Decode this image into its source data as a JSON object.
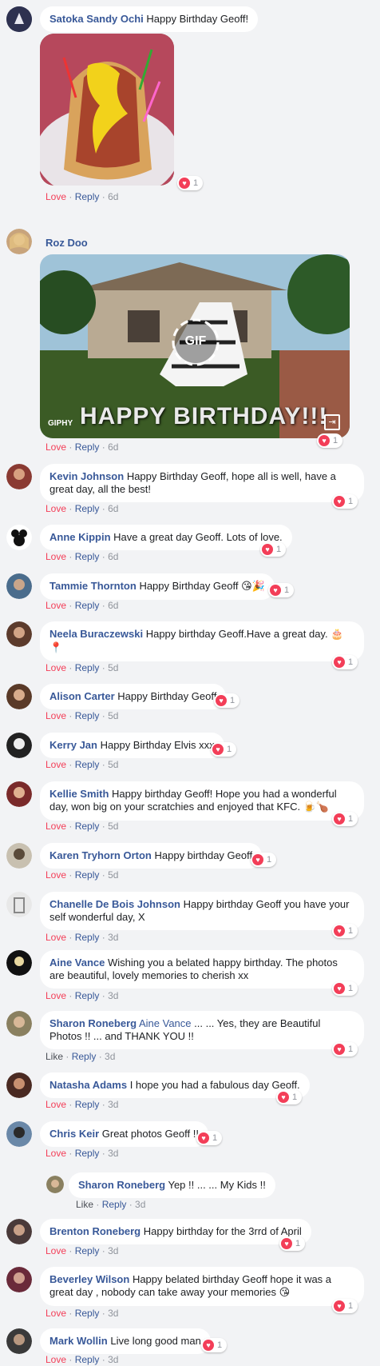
{
  "comments": [
    {
      "name": "Satoka Sandy Ochi",
      "text": "Happy Birthday Geoff!",
      "reaction": "Love",
      "reply": "Reply",
      "time": "6d",
      "count": "1"
    },
    {
      "name": "Roz Doo",
      "text": "",
      "reaction": "Love",
      "reply": "Reply",
      "time": "6d",
      "count": "1",
      "gif_caption": "HAPPY BIRTHDAY!!!",
      "gif_label": "GIF",
      "giphy": "GIPHY"
    },
    {
      "name": "Kevin Johnson",
      "text": "Happy Birthday Geoff, hope all is well, have a great day, all the best!",
      "reaction": "Love",
      "reply": "Reply",
      "time": "6d",
      "count": "1"
    },
    {
      "name": "Anne Kippin",
      "text": "Have a great day Geoff. Lots of love.",
      "reaction": "Love",
      "reply": "Reply",
      "time": "6d",
      "count": "1"
    },
    {
      "name": "Tammie Thornton",
      "text": "Happy Birthday Geoff",
      "emoji": "😘🎉",
      "reaction": "Love",
      "reply": "Reply",
      "time": "6d",
      "count": "1"
    },
    {
      "name": "Neela Buraczewski",
      "text": "Happy birthday Geoff.Have a great day.",
      "emoji": "🎂📍",
      "reaction": "Love",
      "reply": "Reply",
      "time": "5d",
      "count": "1"
    },
    {
      "name": "Alison Carter",
      "text": "Happy Birthday Geoff",
      "reaction": "Love",
      "reply": "Reply",
      "time": "5d",
      "count": "1"
    },
    {
      "name": "Kerry Jan",
      "text": "Happy Birthday Elvis xxx",
      "reaction": "Love",
      "reply": "Reply",
      "time": "5d",
      "count": "1"
    },
    {
      "name": "Kellie Smith",
      "text": "Happy birthday Geoff! Hope you had a wonderful day, won big on your scratchies and enjoyed that KFC.",
      "emoji": "🍺🍗",
      "reaction": "Love",
      "reply": "Reply",
      "time": "5d",
      "count": "1"
    },
    {
      "name": "Karen Tryhorn Orton",
      "text": "Happy birthday Geoff",
      "reaction": "Love",
      "reply": "Reply",
      "time": "5d",
      "count": "1"
    },
    {
      "name": "Chanelle De Bois Johnson",
      "text": "Happy birthday Geoff you have your self wonderful day, X",
      "reaction": "Love",
      "reply": "Reply",
      "time": "3d",
      "count": "1"
    },
    {
      "name": "Aine Vance",
      "text": "Wishing you a belated happy birthday. The photos are beautiful, lovely memories to cherish xx",
      "reaction": "Love",
      "reply": "Reply",
      "time": "3d",
      "count": "1"
    },
    {
      "name": "Sharon Roneberg",
      "mention": "Aine Vance",
      "text": "... ... Yes, they are Beautiful Photos !! ... and THANK YOU !!",
      "reaction": "Like",
      "reply": "Reply",
      "time": "3d",
      "count": "1"
    },
    {
      "name": "Natasha Adams",
      "text": "I hope you had a fabulous day Geoff.",
      "reaction": "Love",
      "reply": "Reply",
      "time": "3d",
      "count": "1"
    },
    {
      "name": "Chris Keir",
      "text": "Great photos Geoff !!",
      "reaction": "Love",
      "reply": "Reply",
      "time": "3d",
      "count": "1"
    },
    {
      "name": "Sharon Roneberg",
      "text": "Yep !! ... ... My Kids !!",
      "reaction": "Like",
      "reply": "Reply",
      "time": "3d"
    },
    {
      "name": "Brenton Roneberg",
      "text": "Happy birthday for the 3rrd of April",
      "reaction": "Love",
      "reply": "Reply",
      "time": "3d",
      "count": "1"
    },
    {
      "name": "Beverley Wilson",
      "text": "Happy belated birthday Geoff hope it was a great day , nobody can take away your memories",
      "emoji": "😘",
      "reaction": "Love",
      "reply": "Reply",
      "time": "3d",
      "count": "1"
    },
    {
      "name": "Mark Wollin",
      "text": "Live long good man",
      "reaction": "Love",
      "reply": "Reply",
      "time": "3d",
      "count": "1"
    }
  ],
  "icons": {
    "reaction": "heart-reaction-icon",
    "fullscreen": "expand-icon"
  },
  "colors": {
    "name": "#385898",
    "love": "#f33e58",
    "background": "#f2f3f5"
  }
}
